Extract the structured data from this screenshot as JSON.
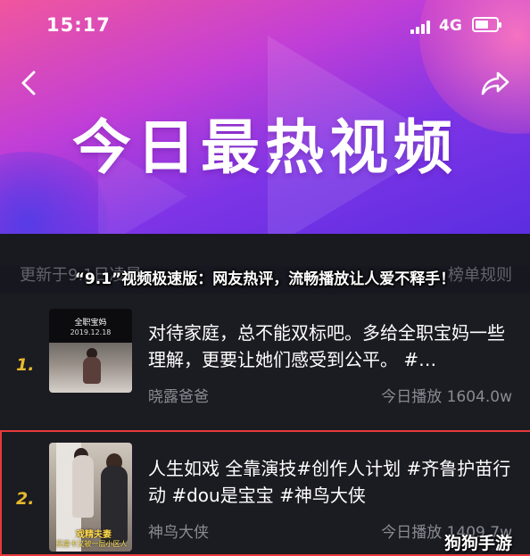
{
  "status": {
    "time": "15:17",
    "network": "4G"
  },
  "header": {
    "title": "今日最热视频"
  },
  "subbar": {
    "left_text": "更新于9.1日凌晨",
    "right_text": "榜单规则"
  },
  "overlay_headline": "“9.1”视频极速版：网友热评，流畅播放让人爱不释手！",
  "items": [
    {
      "rank": "1.",
      "title": "对待家庭，总不能双标吧。多给全职宝妈一些理解，更要让她们感受到公平。 #…",
      "author": "晓露爸爸",
      "plays": "今日播放 1604.0w",
      "thumb_caption": "全职宝妈",
      "thumb_date": "2019.12.18"
    },
    {
      "rank": "2.",
      "title": "人生如戏 全靠演技#创作人计划 #齐鲁护苗行动 #dou是宝宝 #神鸟大侠",
      "author": "神鸟大侠",
      "plays": "今日播放 1409.7w",
      "thumb_caption": "戏精夫妻",
      "thumb_caption2": "买房卡又被一层小区人"
    }
  ],
  "watermark": "狗狗手游",
  "colors": {
    "rank": "#e8b92c",
    "highlight_border": "#e83a3a",
    "banner_start": "#f0569e",
    "banner_end": "#5a2ee0"
  }
}
